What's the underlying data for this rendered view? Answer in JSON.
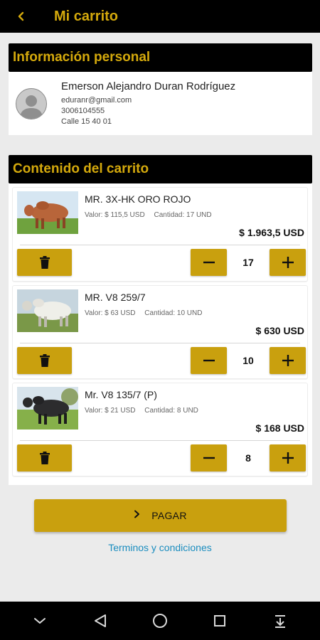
{
  "header": {
    "title": "Mi carrito",
    "back_icon": "chevron-left-icon"
  },
  "personal": {
    "heading": "Información personal",
    "name": "Emerson Alejandro Duran Rodríguez",
    "email": "eduranr@gmail.com",
    "phone": "3006104555",
    "address": "Calle 15 40 01"
  },
  "cart": {
    "heading": "Contenido del carrito",
    "items": [
      {
        "name": "MR. 3X-HK ORO ROJO",
        "valor": "Valor: $ 115,5 USD",
        "cantidad": "Cantidad: 17 UND",
        "total": "$ 1.963,5 USD",
        "qty": "17"
      },
      {
        "name": "MR. V8 259/7",
        "valor": "Valor: $ 63 USD",
        "cantidad": "Cantidad: 10 UND",
        "total": "$ 630 USD",
        "qty": "10"
      },
      {
        "name": "Mr. V8 135/7 (P)",
        "valor": "Valor: $ 21 USD",
        "cantidad": "Cantidad: 8 UND",
        "total": "$ 168 USD",
        "qty": "8"
      }
    ]
  },
  "actions": {
    "pay_label": "PAGAR",
    "terms_label": "Terminos y condiciones"
  },
  "colors": {
    "accent": "#c9a00e",
    "title_gold": "#d4a90c",
    "link": "#1b8dbf"
  },
  "nav_icons": [
    "chevron-down-icon",
    "back-triangle-icon",
    "home-circle-icon",
    "recents-square-icon",
    "notifications-pull-icon"
  ]
}
